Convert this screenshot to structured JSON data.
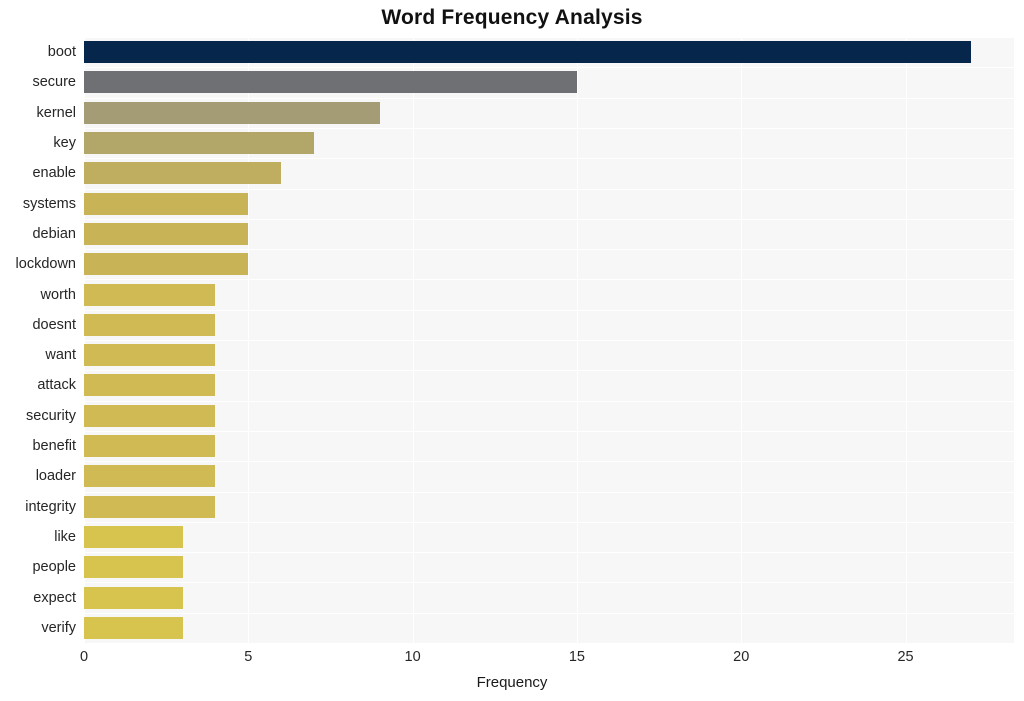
{
  "chart_data": {
    "type": "bar",
    "orientation": "horizontal",
    "title": "Word Frequency Analysis",
    "xlabel": "Frequency",
    "ylabel": "",
    "categories": [
      "boot",
      "secure",
      "kernel",
      "key",
      "enable",
      "systems",
      "debian",
      "lockdown",
      "worth",
      "doesnt",
      "want",
      "attack",
      "security",
      "benefit",
      "loader",
      "integrity",
      "like",
      "people",
      "expect",
      "verify"
    ],
    "values": [
      27,
      15,
      9,
      7,
      6,
      5,
      5,
      5,
      4,
      4,
      4,
      4,
      4,
      4,
      4,
      4,
      3,
      3,
      3,
      3
    ],
    "bar_colors": [
      "#06264b",
      "#6f7073",
      "#a39c75",
      "#b2a668",
      "#bfae60",
      "#c8b457",
      "#c8b457",
      "#c8b457",
      "#cfba53",
      "#cfba53",
      "#cfba53",
      "#cfba53",
      "#cfba53",
      "#cfba53",
      "#cfba53",
      "#cfba53",
      "#d6c44f",
      "#d6c44f",
      "#d6c44f",
      "#d6c44f"
    ],
    "xlim": [
      0,
      28.3
    ],
    "xticks": [
      0,
      5,
      10,
      15,
      20,
      25
    ],
    "xtick_labels": [
      "0",
      "5",
      "10",
      "15",
      "20",
      "25"
    ],
    "grid": true,
    "grid_color": "#ffffff",
    "plot_background": "#f7f7f7",
    "figure_background": "#ffffff",
    "legend": null
  }
}
